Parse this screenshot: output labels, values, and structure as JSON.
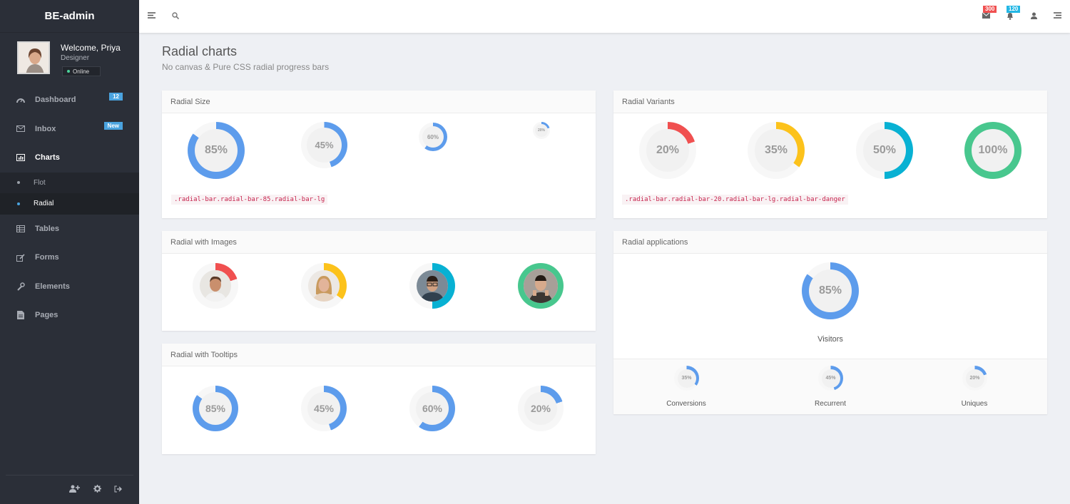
{
  "sidebar": {
    "brand": "BE-admin",
    "profile": {
      "welcome": "Welcome, Priya",
      "role": "Designer",
      "status": "Online"
    },
    "nav": [
      {
        "label": "Dashboard",
        "icon": "dashboard-icon",
        "badge": "12",
        "badge_color": "#4aa3df"
      },
      {
        "label": "Inbox",
        "icon": "inbox-icon",
        "badge": "New",
        "badge_color": "#4aa3df"
      },
      {
        "label": "Charts",
        "icon": "bar-chart-icon",
        "active": true
      }
    ],
    "charts_sub": [
      {
        "label": "Flot"
      },
      {
        "label": "Radial",
        "active": true
      }
    ],
    "nav2": [
      {
        "label": "Tables",
        "icon": "table-icon"
      },
      {
        "label": "Forms",
        "icon": "edit-icon"
      },
      {
        "label": "Elements",
        "icon": "wrench-icon"
      },
      {
        "label": "Pages",
        "icon": "file-icon"
      }
    ],
    "footer_icons": [
      "add-user-icon",
      "gear-icon",
      "sign-out-icon"
    ]
  },
  "topbar": {
    "mail_badge": "300",
    "bell_badge": "120",
    "colors": {
      "mail_badge": "#f05050",
      "bell_badge": "#23b7e5"
    }
  },
  "page": {
    "title": "Radial charts",
    "subtitle": "No canvas & Pure CSS radial progress bars"
  },
  "colors": {
    "primary": "#5d9cec",
    "danger": "#f05050",
    "warning": "#fcc21b",
    "info": "#08b1d3",
    "success": "#48c78e",
    "track": "#f7f7f7",
    "center": "#f1f1f1"
  },
  "cards": {
    "radial_size": {
      "title": "Radial Size",
      "bars": [
        {
          "value": 85,
          "label": "85%"
        },
        {
          "value": 45,
          "label": "45%"
        },
        {
          "value": 60,
          "label": "60%"
        },
        {
          "value": 20,
          "label": "20%"
        }
      ],
      "code": ".radial-bar.radial-bar-85.radial-bar-lg"
    },
    "radial_variants": {
      "title": "Radial Variants",
      "bars": [
        {
          "value": 20,
          "label": "20%",
          "variant": "danger"
        },
        {
          "value": 35,
          "label": "35%",
          "variant": "warning"
        },
        {
          "value": 50,
          "label": "50%",
          "variant": "info"
        },
        {
          "value": 100,
          "label": "100%",
          "variant": "success"
        }
      ],
      "code": ".radial-bar.radial-bar-20.radial-bar-lg.radial-bar-danger"
    },
    "radial_images": {
      "title": "Radial with Images",
      "bars": [
        {
          "value": 20,
          "variant": "danger"
        },
        {
          "value": 35,
          "variant": "warning"
        },
        {
          "value": 50,
          "variant": "info"
        },
        {
          "value": 100,
          "variant": "success"
        }
      ]
    },
    "radial_tooltips": {
      "title": "Radial with Tooltips",
      "bars": [
        {
          "value": 85,
          "label": "85%"
        },
        {
          "value": 45,
          "label": "45%"
        },
        {
          "value": 60,
          "label": "60%"
        },
        {
          "value": 20,
          "label": "20%"
        }
      ]
    },
    "radial_applications": {
      "title": "Radial applications",
      "main": {
        "value": 85,
        "label": "85%",
        "caption": "Visitors"
      },
      "stats": [
        {
          "value": 35,
          "label": "35%",
          "caption": "Conversions"
        },
        {
          "value": 45,
          "label": "45%",
          "caption": "Recurrent"
        },
        {
          "value": 20,
          "label": "20%",
          "caption": "Uniques"
        }
      ]
    }
  }
}
